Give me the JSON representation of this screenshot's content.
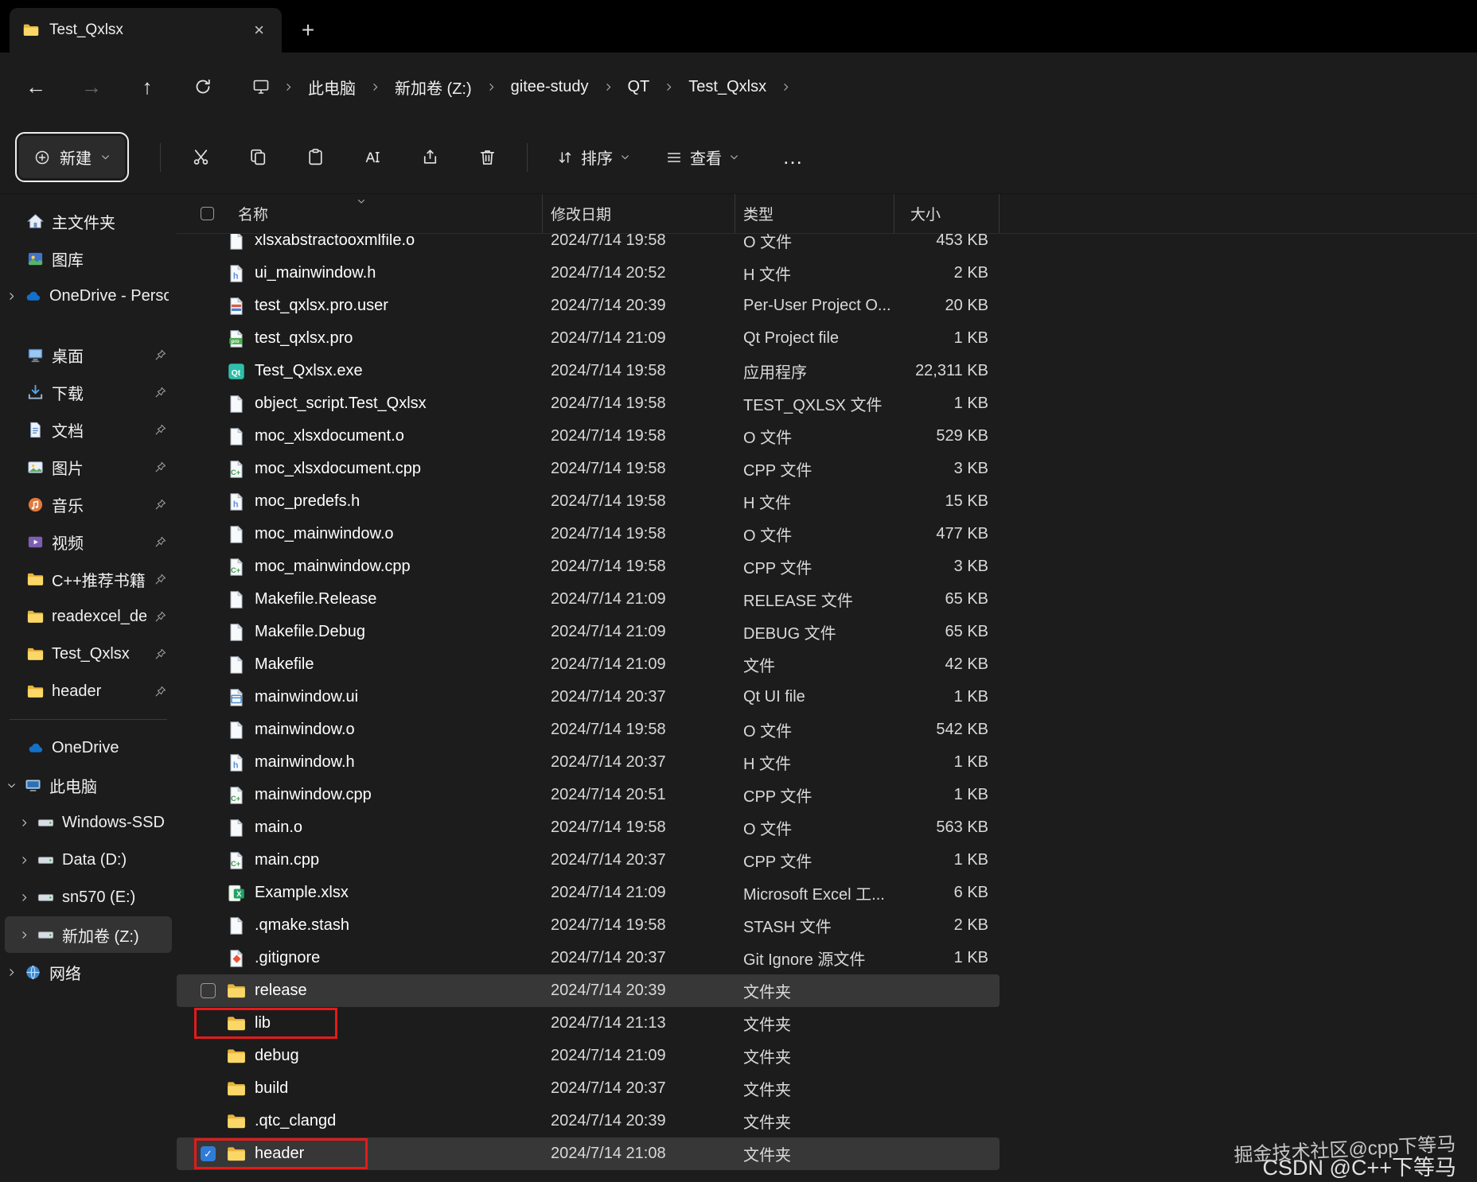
{
  "window": {
    "tab_title": "Test_Qxlsx"
  },
  "icons": {
    "plus": "+",
    "close": "×",
    "more": "…"
  },
  "breadcrumb": {
    "items": [
      "此电脑",
      "新加卷 (Z:)",
      "gitee-study",
      "QT",
      "Test_Qxlsx"
    ]
  },
  "toolbar": {
    "new_label": "新建",
    "sort_label": "排序",
    "view_label": "查看"
  },
  "columns": {
    "name": "名称",
    "date": "修改日期",
    "type": "类型",
    "size": "大小"
  },
  "sidebar": {
    "top": [
      {
        "id": "home",
        "label": "主文件夹",
        "icon": "home"
      },
      {
        "id": "gallery",
        "label": "图库",
        "icon": "gallery"
      },
      {
        "id": "onedrive-personal",
        "label": "OneDrive - Persor",
        "icon": "cloud",
        "chevron": "right"
      }
    ],
    "pinned": [
      {
        "id": "desktop",
        "label": "桌面",
        "icon": "desktop",
        "pinned": true
      },
      {
        "id": "downloads",
        "label": "下载",
        "icon": "download",
        "pinned": true
      },
      {
        "id": "documents",
        "label": "文档",
        "icon": "docs",
        "pinned": true
      },
      {
        "id": "pictures",
        "label": "图片",
        "icon": "pics",
        "pinned": true
      },
      {
        "id": "music",
        "label": "音乐",
        "icon": "music",
        "pinned": true
      },
      {
        "id": "videos",
        "label": "视频",
        "icon": "video",
        "pinned": true
      },
      {
        "id": "cpp-books",
        "label": "C++推荐书籍",
        "icon": "folder",
        "pinned": true
      },
      {
        "id": "readexcel-dem",
        "label": "readexcel_dem",
        "icon": "folder",
        "pinned": true
      },
      {
        "id": "test-qxlsx",
        "label": "Test_Qxlsx",
        "icon": "folder",
        "pinned": true
      },
      {
        "id": "header",
        "label": "header",
        "icon": "folder",
        "pinned": true
      }
    ],
    "bottom": [
      {
        "id": "onedrive",
        "label": "OneDrive",
        "icon": "cloud"
      },
      {
        "id": "this-pc",
        "label": "此电脑",
        "icon": "computer",
        "chevron": "down"
      },
      {
        "id": "windows-ssd-c",
        "label": "Windows-SSD (C",
        "icon": "drive",
        "chevron": "right",
        "indent": true
      },
      {
        "id": "data-d",
        "label": "Data (D:)",
        "icon": "drive",
        "chevron": "right",
        "indent": true
      },
      {
        "id": "sn570-e",
        "label": "sn570 (E:)",
        "icon": "drive",
        "chevron": "right",
        "indent": true
      },
      {
        "id": "new-volume-z",
        "label": "新加卷 (Z:)",
        "icon": "drive",
        "chevron": "right",
        "indent": true,
        "selected": true
      },
      {
        "id": "network",
        "label": "网络",
        "icon": "network",
        "chevron": "right"
      }
    ]
  },
  "files": [
    {
      "name": "xlsxabstractooxmlfile.o",
      "date": "2024/7/14 19:58",
      "type": "O 文件",
      "size": "453 KB",
      "icon": "page",
      "clipped": true
    },
    {
      "name": "ui_mainwindow.h",
      "date": "2024/7/14 20:52",
      "type": "H 文件",
      "size": "2 KB",
      "icon": "h"
    },
    {
      "name": "test_qxlsx.pro.user",
      "date": "2024/7/14 20:39",
      "type": "Per-User Project O...",
      "size": "20 KB",
      "icon": "user"
    },
    {
      "name": "test_qxlsx.pro",
      "date": "2024/7/14 21:09",
      "type": "Qt Project file",
      "size": "1 KB",
      "icon": "pro"
    },
    {
      "name": "Test_Qxlsx.exe",
      "date": "2024/7/14 19:58",
      "type": "应用程序",
      "size": "22,311 KB",
      "icon": "exe"
    },
    {
      "name": "object_script.Test_Qxlsx",
      "date": "2024/7/14 19:58",
      "type": "TEST_QXLSX 文件",
      "size": "1 KB",
      "icon": "page"
    },
    {
      "name": "moc_xlsxdocument.o",
      "date": "2024/7/14 19:58",
      "type": "O 文件",
      "size": "529 KB",
      "icon": "page"
    },
    {
      "name": "moc_xlsxdocument.cpp",
      "date": "2024/7/14 19:58",
      "type": "CPP 文件",
      "size": "3 KB",
      "icon": "cpp"
    },
    {
      "name": "moc_predefs.h",
      "date": "2024/7/14 19:58",
      "type": "H 文件",
      "size": "15 KB",
      "icon": "h"
    },
    {
      "name": "moc_mainwindow.o",
      "date": "2024/7/14 19:58",
      "type": "O 文件",
      "size": "477 KB",
      "icon": "page"
    },
    {
      "name": "moc_mainwindow.cpp",
      "date": "2024/7/14 19:58",
      "type": "CPP 文件",
      "size": "3 KB",
      "icon": "cpp"
    },
    {
      "name": "Makefile.Release",
      "date": "2024/7/14 21:09",
      "type": "RELEASE 文件",
      "size": "65 KB",
      "icon": "page"
    },
    {
      "name": "Makefile.Debug",
      "date": "2024/7/14 21:09",
      "type": "DEBUG 文件",
      "size": "65 KB",
      "icon": "page"
    },
    {
      "name": "Makefile",
      "date": "2024/7/14 21:09",
      "type": "文件",
      "size": "42 KB",
      "icon": "page"
    },
    {
      "name": "mainwindow.ui",
      "date": "2024/7/14 20:37",
      "type": "Qt UI file",
      "size": "1 KB",
      "icon": "ui"
    },
    {
      "name": "mainwindow.o",
      "date": "2024/7/14 19:58",
      "type": "O 文件",
      "size": "542 KB",
      "icon": "page"
    },
    {
      "name": "mainwindow.h",
      "date": "2024/7/14 20:37",
      "type": "H 文件",
      "size": "1 KB",
      "icon": "h"
    },
    {
      "name": "mainwindow.cpp",
      "date": "2024/7/14 20:51",
      "type": "CPP 文件",
      "size": "1 KB",
      "icon": "cpp"
    },
    {
      "name": "main.o",
      "date": "2024/7/14 19:58",
      "type": "O 文件",
      "size": "563 KB",
      "icon": "page"
    },
    {
      "name": "main.cpp",
      "date": "2024/7/14 20:37",
      "type": "CPP 文件",
      "size": "1 KB",
      "icon": "cpp"
    },
    {
      "name": "Example.xlsx",
      "date": "2024/7/14 21:09",
      "type": "Microsoft Excel 工...",
      "size": "6 KB",
      "icon": "xlsx"
    },
    {
      "name": ".qmake.stash",
      "date": "2024/7/14 19:58",
      "type": "STASH 文件",
      "size": "2 KB",
      "icon": "page"
    },
    {
      "name": ".gitignore",
      "date": "2024/7/14 20:37",
      "type": "Git Ignore 源文件",
      "size": "1 KB",
      "icon": "git"
    },
    {
      "name": "release",
      "date": "2024/7/14 20:39",
      "type": "文件夹",
      "size": "",
      "icon": "folder",
      "selected": true,
      "checkbox": true
    },
    {
      "name": "lib",
      "date": "2024/7/14 21:13",
      "type": "文件夹",
      "size": "",
      "icon": "folder",
      "redbox": true
    },
    {
      "name": "debug",
      "date": "2024/7/14 21:09",
      "type": "文件夹",
      "size": "",
      "icon": "folder"
    },
    {
      "name": "build",
      "date": "2024/7/14 20:37",
      "type": "文件夹",
      "size": "",
      "icon": "folder"
    },
    {
      "name": ".qtc_clangd",
      "date": "2024/7/14 20:39",
      "type": "文件夹",
      "size": "",
      "icon": "folder"
    },
    {
      "name": "header",
      "date": "2024/7/14 21:08",
      "type": "文件夹",
      "size": "",
      "icon": "folder",
      "selected": true,
      "checkbox": true,
      "checked": true,
      "redbox": true
    }
  ],
  "watermark": {
    "line1": "掘金技术社区@cpp下等马",
    "line2": "CSDN @C++下等马"
  }
}
